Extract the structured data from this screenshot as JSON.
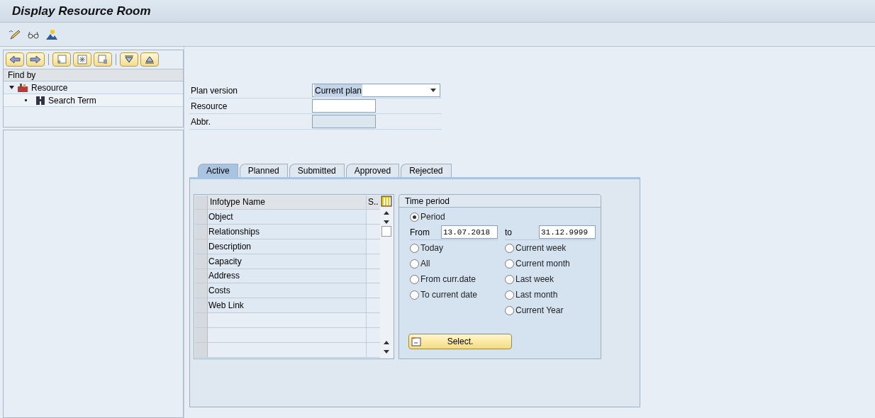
{
  "window": {
    "title": "Display Resource Room"
  },
  "nav": {
    "header": "Find by",
    "tree": [
      {
        "label": "Resource",
        "expanded": true,
        "children": [
          {
            "label": "Search Term"
          }
        ]
      }
    ]
  },
  "form": {
    "plan_version": {
      "label": "Plan version",
      "value": "Current plan"
    },
    "resource": {
      "label": "Resource"
    },
    "abbr": {
      "label": "Abbr.",
      "disabled": true
    }
  },
  "tabs": [
    {
      "label": "Active",
      "selected": true
    },
    {
      "label": "Planned",
      "selected": false
    },
    {
      "label": "Submitted",
      "selected": false
    },
    {
      "label": "Approved",
      "selected": false
    },
    {
      "label": "Rejected",
      "selected": false
    }
  ],
  "table": {
    "columns": [
      "Infotype Name",
      "S.."
    ],
    "rows": [
      "Object",
      "Relationships",
      "Description",
      "Capacity",
      "Address",
      "Costs",
      "Web Link"
    ]
  },
  "time_period": {
    "title": "Time period",
    "period": {
      "label": "Period",
      "selected": true
    },
    "from": {
      "label": "From",
      "value": "13.07.2018"
    },
    "to": {
      "label": "to",
      "value": "31.12.9999"
    },
    "left_options": [
      {
        "label": "Today",
        "selected": false
      },
      {
        "label": "All",
        "selected": false
      },
      {
        "label": "From curr.date",
        "selected": false
      },
      {
        "label": "To current date",
        "selected": false
      }
    ],
    "right_options": [
      {
        "label": "Current week",
        "selected": false
      },
      {
        "label": "Current month",
        "selected": false
      },
      {
        "label": "Last week",
        "selected": false
      },
      {
        "label": "Last month",
        "selected": false
      },
      {
        "label": "Current Year",
        "selected": false
      }
    ],
    "button": "Select."
  }
}
